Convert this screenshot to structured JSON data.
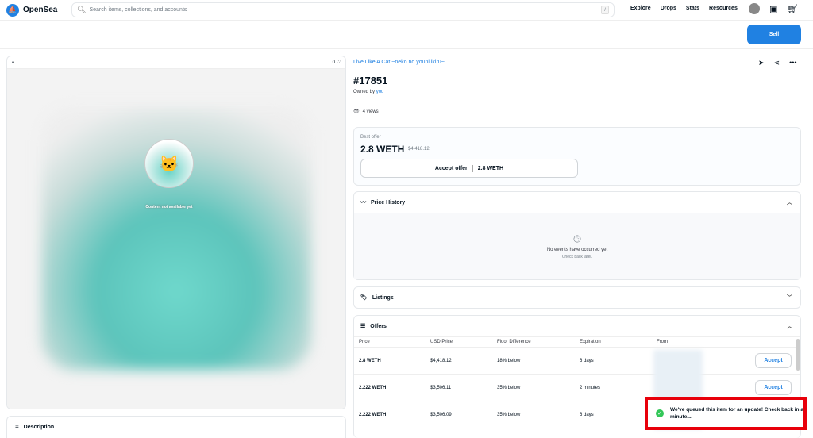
{
  "header": {
    "logo_text": "OpenSea",
    "search_placeholder": "Search items, collections, and accounts",
    "search_shortcut": "/",
    "nav": [
      "Explore",
      "Drops",
      "Stats",
      "Resources"
    ],
    "sell_label": "Sell"
  },
  "media": {
    "favorites": "0",
    "chain_icon": "ethereum-icon",
    "not_available": "Content not available yet"
  },
  "description": {
    "label": "Description"
  },
  "item": {
    "collection": "Live Like A Cat ~neko no youni ikiru~",
    "title": "#17851",
    "owned_by_label": "Owned by",
    "owner": "you",
    "views": "4 views"
  },
  "best_offer": {
    "label": "Best offer",
    "value": "2.8 WETH",
    "usd": "$4,418.12",
    "accept_label": "Accept offer",
    "accept_value": "2.8 WETH"
  },
  "price_history": {
    "title": "Price History",
    "empty_title": "No events have occurred yet",
    "empty_sub": "Check back later."
  },
  "listings": {
    "title": "Listings"
  },
  "offers": {
    "title": "Offers",
    "columns": [
      "Price",
      "USD Price",
      "Floor Difference",
      "Expiration",
      "From"
    ],
    "rows": [
      {
        "price": "2.8 WETH",
        "usd": "$4,418.12",
        "floor": "18% below",
        "expiration": "6 days",
        "action": "Accept"
      },
      {
        "price": "2.222 WETH",
        "usd": "$3,506.11",
        "floor": "35% below",
        "expiration": "2 minutes",
        "action": "Accept"
      },
      {
        "price": "2.222 WETH",
        "usd": "$3,506.09",
        "floor": "35% below",
        "expiration": "6 days",
        "action": ""
      }
    ]
  },
  "toast": {
    "message": "We've queued this item for an update! Check back in a minute..."
  },
  "colors": {
    "accent": "#2081e2",
    "toast_border": "#e8000b",
    "success": "#34c759"
  }
}
